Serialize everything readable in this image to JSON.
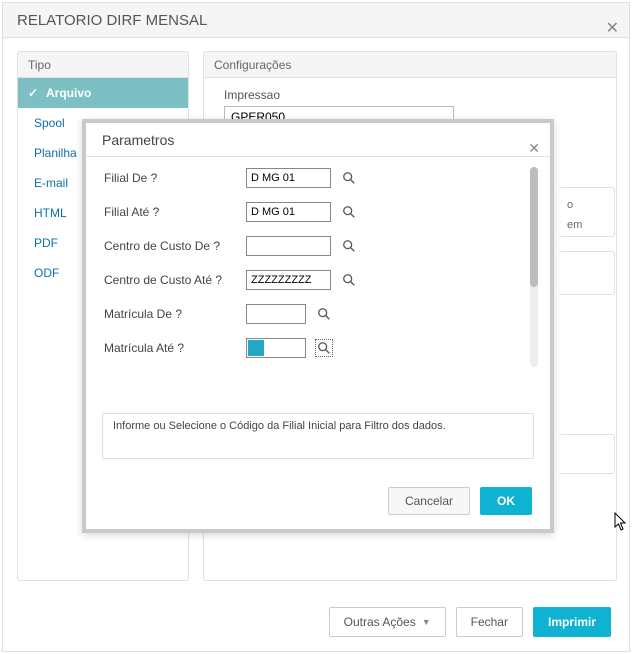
{
  "outer": {
    "title": "RELATORIO DIRF MENSAL"
  },
  "tipo": {
    "header": "Tipo",
    "items": [
      {
        "label": "Arquivo",
        "active": true
      },
      {
        "label": "Spool",
        "active": false
      },
      {
        "label": "Planilha",
        "active": false
      },
      {
        "label": "E-mail",
        "active": false
      },
      {
        "label": "HTML",
        "active": false
      },
      {
        "label": "PDF",
        "active": false
      },
      {
        "label": "ODF",
        "active": false
      }
    ]
  },
  "config": {
    "header": "Configurações",
    "impressao_label": "Impressao",
    "impressao_value": "GPER050",
    "phantom_line1": "o",
    "phantom_line2": "em"
  },
  "bottom": {
    "outras": "Outras Ações",
    "fechar": "Fechar",
    "imprimir": "Imprimir"
  },
  "modal": {
    "title": "Parametros",
    "rows": [
      {
        "label": "Filial De ?",
        "value": "D MG 01"
      },
      {
        "label": "Filial Até ?",
        "value": "D MG 01"
      },
      {
        "label": "Centro de Custo De ?",
        "value": ""
      },
      {
        "label": "Centro de Custo Até ?",
        "value": "ZZZZZZZZZ"
      },
      {
        "label": "Matrícula De ?",
        "value": ""
      },
      {
        "label": "Matrícula Até ?",
        "value": ""
      }
    ],
    "help": "Informe ou Selecione o Código da Filial Inicial para Filtro dos dados.",
    "cancel": "Cancelar",
    "ok": "OK"
  }
}
